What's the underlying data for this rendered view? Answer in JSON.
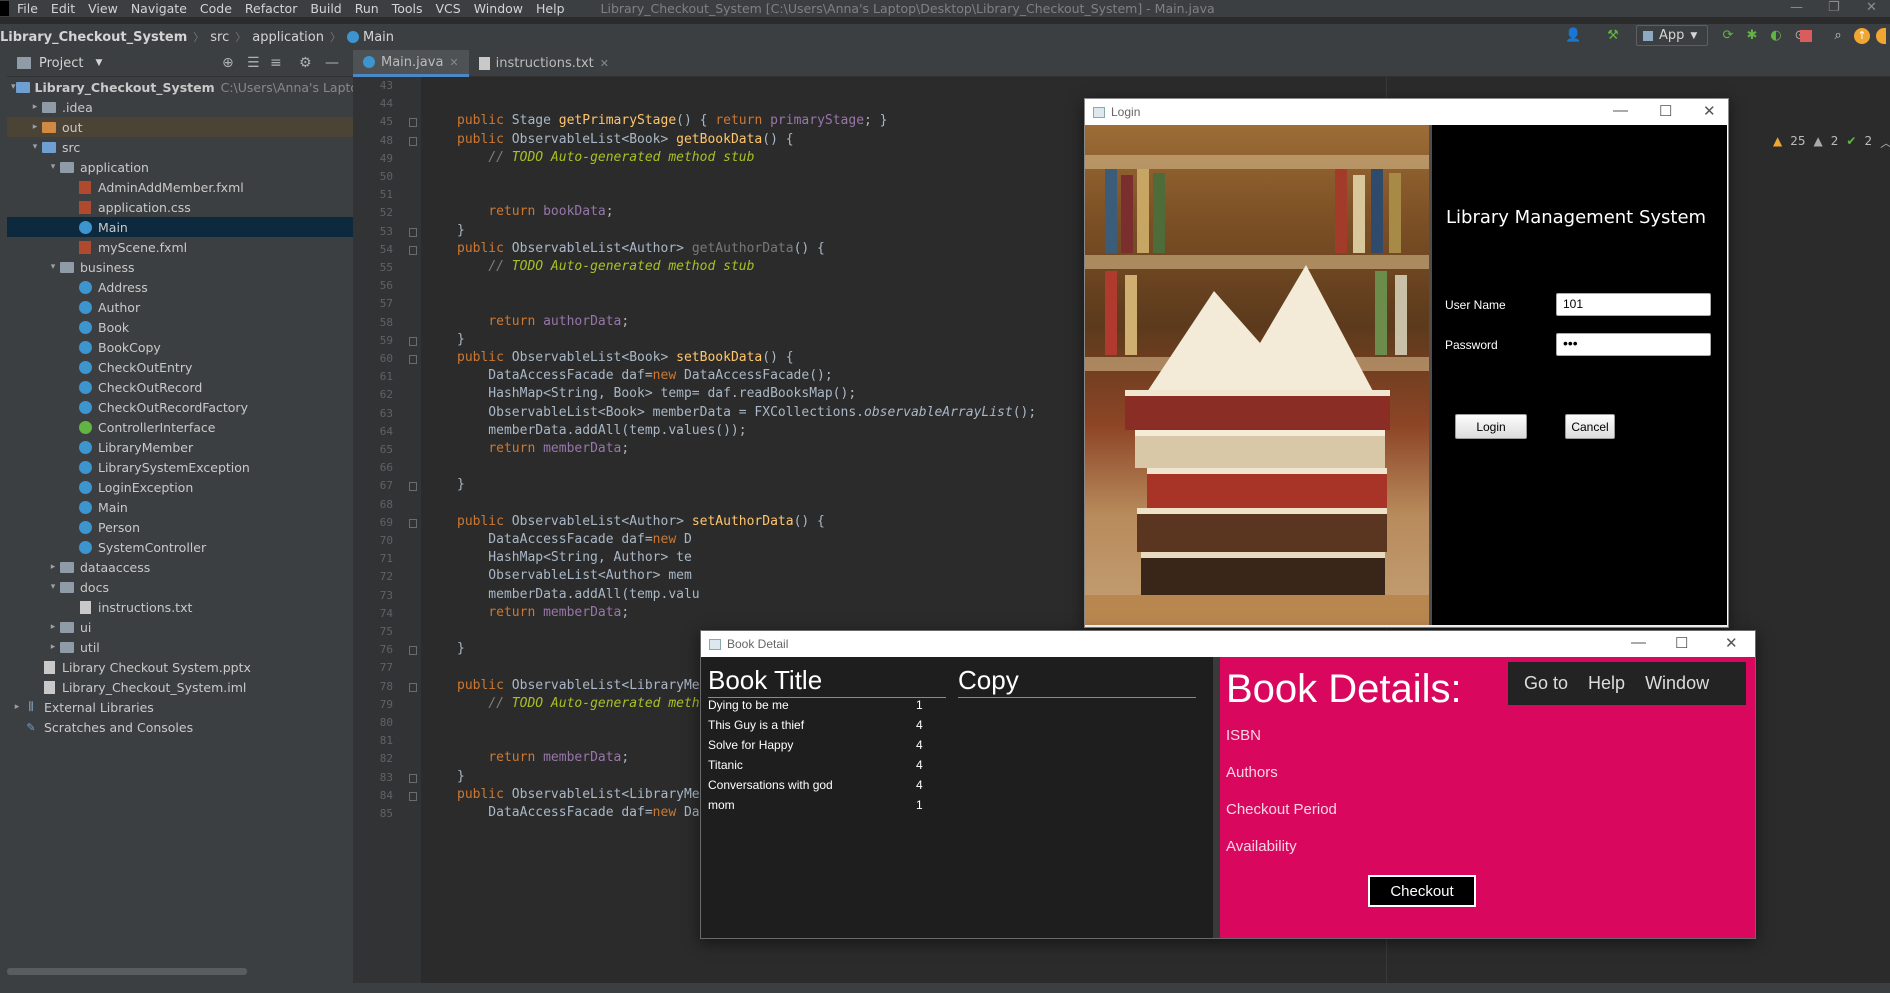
{
  "menubar": {
    "items": [
      "File",
      "Edit",
      "View",
      "Navigate",
      "Code",
      "Refactor",
      "Build",
      "Run",
      "Tools",
      "VCS",
      "Window",
      "Help"
    ],
    "title": "Library_Checkout_System [C:\\Users\\Anna's Laptop\\Desktop\\Library_Checkout_System] - Main.java"
  },
  "navbar": {
    "crumbs": [
      "Library_Checkout_System",
      "src",
      "application",
      "Main"
    ],
    "run_config": "App"
  },
  "project": {
    "header": "Project",
    "root_label": "Library_Checkout_System",
    "root_path": "C:\\Users\\Anna's Laptop\\Desk",
    "rows": [
      {
        "label": "Library_Checkout_System",
        "depth": 0,
        "arrow": "▾",
        "icon": "folder-blue",
        "hint": "C:\\Users\\Anna's Laptop\\Desk"
      },
      {
        "label": ".idea",
        "depth": 1,
        "arrow": "▸",
        "icon": "folder"
      },
      {
        "label": "out",
        "depth": 1,
        "arrow": "▸",
        "icon": "folder-orange",
        "highlight": true
      },
      {
        "label": "src",
        "depth": 1,
        "arrow": "▾",
        "icon": "folder-blue"
      },
      {
        "label": "application",
        "depth": 2,
        "arrow": "▾",
        "icon": "folder"
      },
      {
        "label": "AdminAddMember.fxml",
        "depth": 3,
        "arrow": "",
        "icon": "fxml"
      },
      {
        "label": "application.css",
        "depth": 3,
        "arrow": "",
        "icon": "fxml"
      },
      {
        "label": "Main",
        "depth": 3,
        "arrow": "",
        "icon": "class",
        "selected": true
      },
      {
        "label": "myScene.fxml",
        "depth": 3,
        "arrow": "",
        "icon": "fxml"
      },
      {
        "label": "business",
        "depth": 2,
        "arrow": "▾",
        "icon": "folder"
      },
      {
        "label": "Address",
        "depth": 3,
        "arrow": "",
        "icon": "class"
      },
      {
        "label": "Author",
        "depth": 3,
        "arrow": "",
        "icon": "class"
      },
      {
        "label": "Book",
        "depth": 3,
        "arrow": "",
        "icon": "class"
      },
      {
        "label": "BookCopy",
        "depth": 3,
        "arrow": "",
        "icon": "class"
      },
      {
        "label": "CheckOutEntry",
        "depth": 3,
        "arrow": "",
        "icon": "class"
      },
      {
        "label": "CheckOutRecord",
        "depth": 3,
        "arrow": "",
        "icon": "class"
      },
      {
        "label": "CheckOutRecordFactory",
        "depth": 3,
        "arrow": "",
        "icon": "class"
      },
      {
        "label": "ControllerInterface",
        "depth": 3,
        "arrow": "",
        "icon": "interface"
      },
      {
        "label": "LibraryMember",
        "depth": 3,
        "arrow": "",
        "icon": "class"
      },
      {
        "label": "LibrarySystemException",
        "depth": 3,
        "arrow": "",
        "icon": "class"
      },
      {
        "label": "LoginException",
        "depth": 3,
        "arrow": "",
        "icon": "class"
      },
      {
        "label": "Main",
        "depth": 3,
        "arrow": "",
        "icon": "class"
      },
      {
        "label": "Person",
        "depth": 3,
        "arrow": "",
        "icon": "class"
      },
      {
        "label": "SystemController",
        "depth": 3,
        "arrow": "",
        "icon": "class"
      },
      {
        "label": "dataaccess",
        "depth": 2,
        "arrow": "▸",
        "icon": "folder"
      },
      {
        "label": "docs",
        "depth": 2,
        "arrow": "▾",
        "icon": "folder"
      },
      {
        "label": "instructions.txt",
        "depth": 3,
        "arrow": "",
        "icon": "text"
      },
      {
        "label": "ui",
        "depth": 2,
        "arrow": "▸",
        "icon": "folder"
      },
      {
        "label": "util",
        "depth": 2,
        "arrow": "▸",
        "icon": "folder"
      },
      {
        "label": "Library Checkout System.pptx",
        "depth": 1,
        "arrow": "",
        "icon": "text"
      },
      {
        "label": "Library_Checkout_System.iml",
        "depth": 1,
        "arrow": "",
        "icon": "text"
      },
      {
        "label": "External Libraries",
        "depth": 0,
        "arrow": "▸",
        "icon": "library"
      },
      {
        "label": "Scratches and Consoles",
        "depth": 0,
        "arrow": "",
        "icon": "scratch"
      }
    ]
  },
  "editor": {
    "tabs": [
      {
        "label": "Main.java",
        "active": true
      },
      {
        "label": "instructions.txt",
        "active": false
      }
    ],
    "inspections": {
      "warnings": "25",
      "weak": "2",
      "ok": "2"
    },
    "line_numbers": [
      "43",
      "44",
      "45",
      "48",
      "49",
      "50",
      "51",
      "52",
      "53",
      "54",
      "55",
      "56",
      "57",
      "58",
      "59",
      "60",
      "61",
      "62",
      "63",
      "64",
      "65",
      "66",
      "67",
      "68",
      "69",
      "70",
      "71",
      "72",
      "73",
      "74",
      "75",
      "76",
      "77",
      "78",
      "79",
      "80",
      "81",
      "82",
      "83",
      "84",
      "85"
    ],
    "code_lines": [
      "",
      "",
      "public Stage getPrimaryStage() { return primaryStage; }",
      "public ObservableList<Book> getBookData() {",
      "    // TODO Auto-generated method stub",
      "",
      "",
      "    return bookData;",
      "}",
      "public ObservableList<Author> getAuthorData() {",
      "    // TODO Auto-generated method stub",
      "",
      "",
      "    return authorData;",
      "}",
      "public ObservableList<Book> setBookData() {",
      "    DataAccessFacade daf=new DataAccessFacade();",
      "    HashMap<String, Book> temp= daf.readBooksMap();",
      "    ObservableList<Book> memberData = FXCollections.observableArrayList();",
      "    memberData.addAll(temp.values());",
      "    return memberData;",
      "",
      "}",
      "",
      "public ObservableList<Author> setAuthorData() {",
      "    DataAccessFacade daf=new D",
      "    HashMap<String, Author> te",
      "    ObservableList<Author> mem",
      "    memberData.addAll(temp.valu",
      "    return memberData;",
      "",
      "}",
      "",
      "public ObservableList<LibraryMe",
      "    // TODO Auto-generated meth",
      "",
      "",
      "    return memberData;",
      "}",
      "public ObservableList<LibraryMember> setMemberData() {",
      "    DataAccessFacade daf=new DataAccessFacade();"
    ]
  },
  "login": {
    "window_title": "Login",
    "heading": "Library Management System",
    "username_label": "User Name",
    "username_value": "101",
    "password_label": "Password",
    "password_value": "•••",
    "login_button": "Login",
    "cancel_button": "Cancel"
  },
  "book_detail": {
    "window_title": "Book Detail",
    "col_title": "Book Title",
    "col_copy": "Copy",
    "rows": [
      {
        "title": "Dying to be me",
        "copy": "1"
      },
      {
        "title": "This Guy is a thief",
        "copy": "4"
      },
      {
        "title": "Solve for Happy",
        "copy": "4"
      },
      {
        "title": "Titanic",
        "copy": "4"
      },
      {
        "title": "Conversations with god",
        "copy": "4"
      },
      {
        "title": "mom",
        "copy": "1"
      }
    ],
    "details_title": "Book Details:",
    "fields": [
      "ISBN",
      "Authors",
      "Checkout Period",
      "Availability"
    ],
    "menu": [
      "Go to",
      "Help",
      "Window"
    ],
    "checkout_button": "Checkout"
  }
}
